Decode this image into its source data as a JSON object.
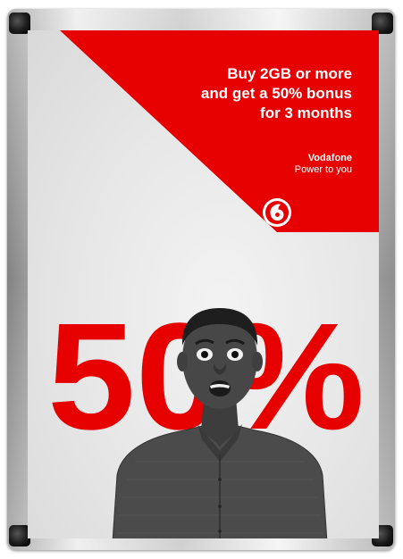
{
  "poster": {
    "headline_lines": [
      "Buy 2GB or more",
      "and get a 50% bonus",
      "for 3 months"
    ],
    "brand_name": "Vodafone",
    "brand_tagline": "Power to you",
    "big_figure": "50%"
  },
  "colors": {
    "brand_red": "#e60000",
    "frame_silver": "#c8c8c8",
    "poster_background": "#e7e7e7"
  },
  "icons": [
    "vodafone-logo-icon",
    "frame-corner-icon"
  ]
}
